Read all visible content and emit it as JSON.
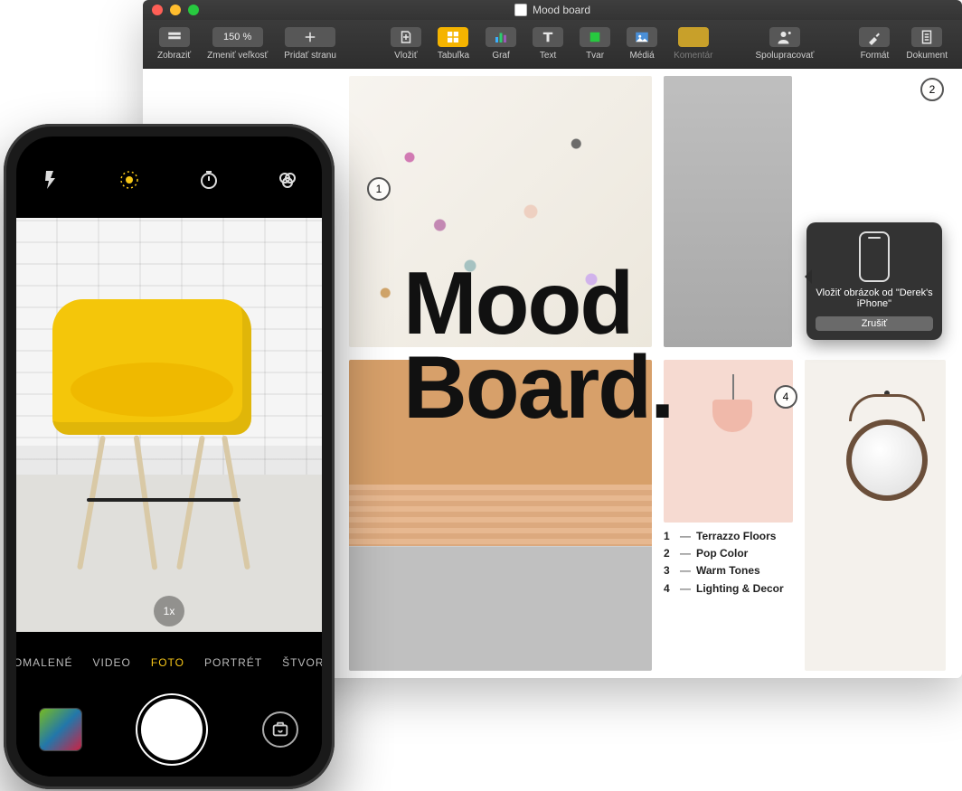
{
  "mac": {
    "window_title": "Mood board",
    "toolbar": {
      "view": "Zobraziť",
      "zoom": "Zmeniť veľkosť",
      "zoom_value": "150 %",
      "add_page": "Pridať stranu",
      "insert": "Vložiť",
      "table": "Tabuľka",
      "chart": "Graf",
      "text": "Text",
      "shape": "Tvar",
      "media": "Médiá",
      "comment": "Komentár",
      "collaborate": "Spolupracovať",
      "format": "Formát",
      "document": "Dokument"
    },
    "board": {
      "heading": "Mood\nBoard.",
      "markers": {
        "1": "1",
        "2": "2",
        "4": "4"
      },
      "legend": [
        {
          "n": "1",
          "label": "Terrazzo Floors"
        },
        {
          "n": "2",
          "label": "Pop Color"
        },
        {
          "n": "3",
          "label": "Warm Tones"
        },
        {
          "n": "4",
          "label": "Lighting & Decor"
        }
      ]
    },
    "callout": {
      "text": "Vložiť obrázok od \"Derek's iPhone\"",
      "cancel": "Zrušiť"
    }
  },
  "iphone": {
    "zoom_badge": "1x",
    "modes": {
      "slow": "SPOMALENÉ",
      "video": "VIDEO",
      "photo": "FOTO",
      "portrait": "PORTRÉT",
      "square": "ŠTVOREC"
    }
  }
}
